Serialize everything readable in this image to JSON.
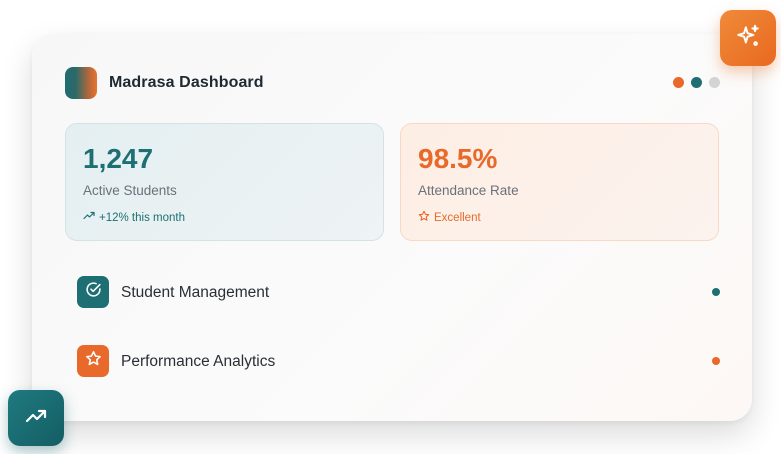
{
  "app": {
    "title": "Madrasa Dashboard"
  },
  "colors": {
    "teal": "#1d6f74",
    "orange": "#e8692a",
    "grey": "#d4d4d4"
  },
  "header": {
    "indicator_dots": [
      {
        "name": "indicator-dot-orange",
        "color": "#e8692a"
      },
      {
        "name": "indicator-dot-teal",
        "color": "#1d6f74"
      },
      {
        "name": "indicator-dot-grey",
        "color": "#d4d4d4"
      }
    ]
  },
  "stats": [
    {
      "value": "1,247",
      "label": "Active Students",
      "note": "+12% this month",
      "note_icon": "trending-up-icon",
      "color": "#1d6f74"
    },
    {
      "value": "98.5%",
      "label": "Attendance Rate",
      "note": "Excellent",
      "note_icon": "star-icon",
      "color": "#e8692a"
    }
  ],
  "menu": [
    {
      "label": "Student Management",
      "icon": "check-circle-icon",
      "color": "#1d6f74"
    },
    {
      "label": "Performance Analytics",
      "icon": "star-icon",
      "color": "#e8692a"
    }
  ],
  "fabs": {
    "top": {
      "icon": "sparkles-icon"
    },
    "bottom": {
      "icon": "trending-up-icon"
    }
  }
}
